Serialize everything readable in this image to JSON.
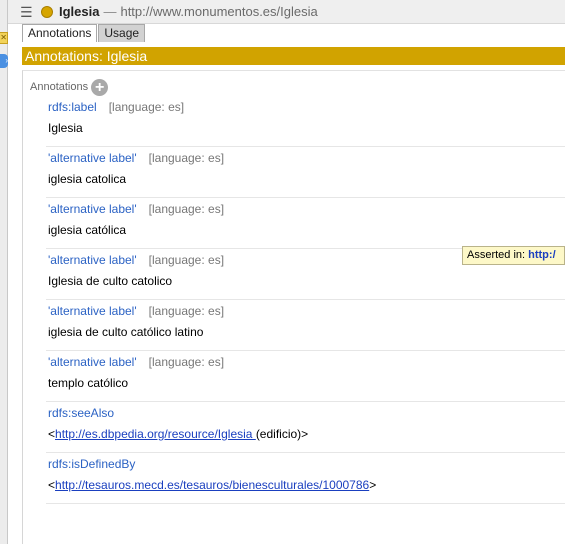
{
  "window": {
    "entity_name": "Iglesia",
    "separator": "—",
    "entity_iri": "http://www.monumentos.es/Iglesia"
  },
  "tabs": [
    {
      "label": "Annotations",
      "active": true
    },
    {
      "label": "Usage",
      "active": false
    }
  ],
  "section_header": "Annotations: Iglesia",
  "annotations_label": "Annotations",
  "add_icon_glyph": "+",
  "annotations": [
    {
      "property": "rdfs:label",
      "language": "[language: es]",
      "value": "Iglesia"
    },
    {
      "property": "'alternative label'",
      "language": "[language: es]",
      "value": "iglesia catolica"
    },
    {
      "property": "'alternative label'",
      "language": "[language: es]",
      "value": "iglesia católica"
    },
    {
      "property": "'alternative label'",
      "language": "[language: es]",
      "value": "Iglesia de culto catolico"
    },
    {
      "property": "'alternative label'",
      "language": "[language: es]",
      "value": "iglesia de culto católico latino"
    },
    {
      "property": "'alternative label'",
      "language": "[language: es]",
      "value": "templo católico"
    },
    {
      "property": "rdfs:seeAlso",
      "value_prefix": "<",
      "value_link": "http://es.dbpedia.org/resource/Iglesia ",
      "value_suffix": "(edificio)>"
    },
    {
      "property": "rdfs:isDefinedBy",
      "value_prefix": "<",
      "value_link": "http://tesauros.mecd.es/tesauros/bienesculturales/1000786",
      "value_suffix": ">"
    }
  ],
  "tooltip": {
    "label": "Asserted in: ",
    "link": "http:/"
  },
  "colors": {
    "header_bar": "#d1a300",
    "entity_dot": "#d6a500",
    "property_link": "#2b62c4",
    "hyperlink": "#1a3fbf",
    "tooltip_bg": "#fdf8c8"
  },
  "icons": [
    "menu-icon",
    "entity-class-icon",
    "add-annotation-icon",
    "close-view-icon",
    "navigate-arrow-icon"
  ]
}
